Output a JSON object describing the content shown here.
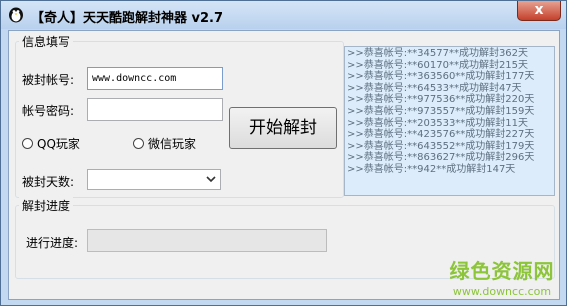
{
  "window": {
    "title": "【奇人】天天酷跑解封神器  v2.7",
    "close_label": "x"
  },
  "info_group": {
    "title": "信息填写",
    "account_label": "被封帐号:",
    "account_value": "www.downcc.com",
    "password_label": "帐号密码:",
    "password_value": "",
    "unlock_button": "开始解封",
    "radio_qq": "QQ玩家",
    "radio_wechat": "微信玩家",
    "days_label": "被封天数:",
    "days_value": ""
  },
  "log": {
    "lines": [
      ">>恭喜帐号:**34577**成功解封362天",
      ">>恭喜帐号:**60170**成功解封215天",
      ">>恭喜帐号:**363560**成功解封177天",
      ">>恭喜帐号:**64533**成功解封47天",
      ">>恭喜帐号:**977536**成功解封220天",
      ">>恭喜帐号:**973557**成功解封159天",
      ">>恭喜帐号:**203533**成功解封11天",
      ">>恭喜帐号:**423576**成功解封227天",
      ">>恭喜帐号:**643552**成功解封179天",
      ">>恭喜帐号:**863627**成功解封296天",
      ">>恭喜帐号:**942**成功解封147天"
    ]
  },
  "progress_group": {
    "title": "解封进度",
    "progress_label": "进行进度:",
    "progress_value": 0
  },
  "watermark": {
    "title": "绿色资源网",
    "url": "www.downcc.com"
  },
  "colors": {
    "titlebar": "#c3d9f1",
    "close_button": "#c4402b",
    "log_background": "#dcecfa",
    "watermark": "#8cc43a"
  }
}
